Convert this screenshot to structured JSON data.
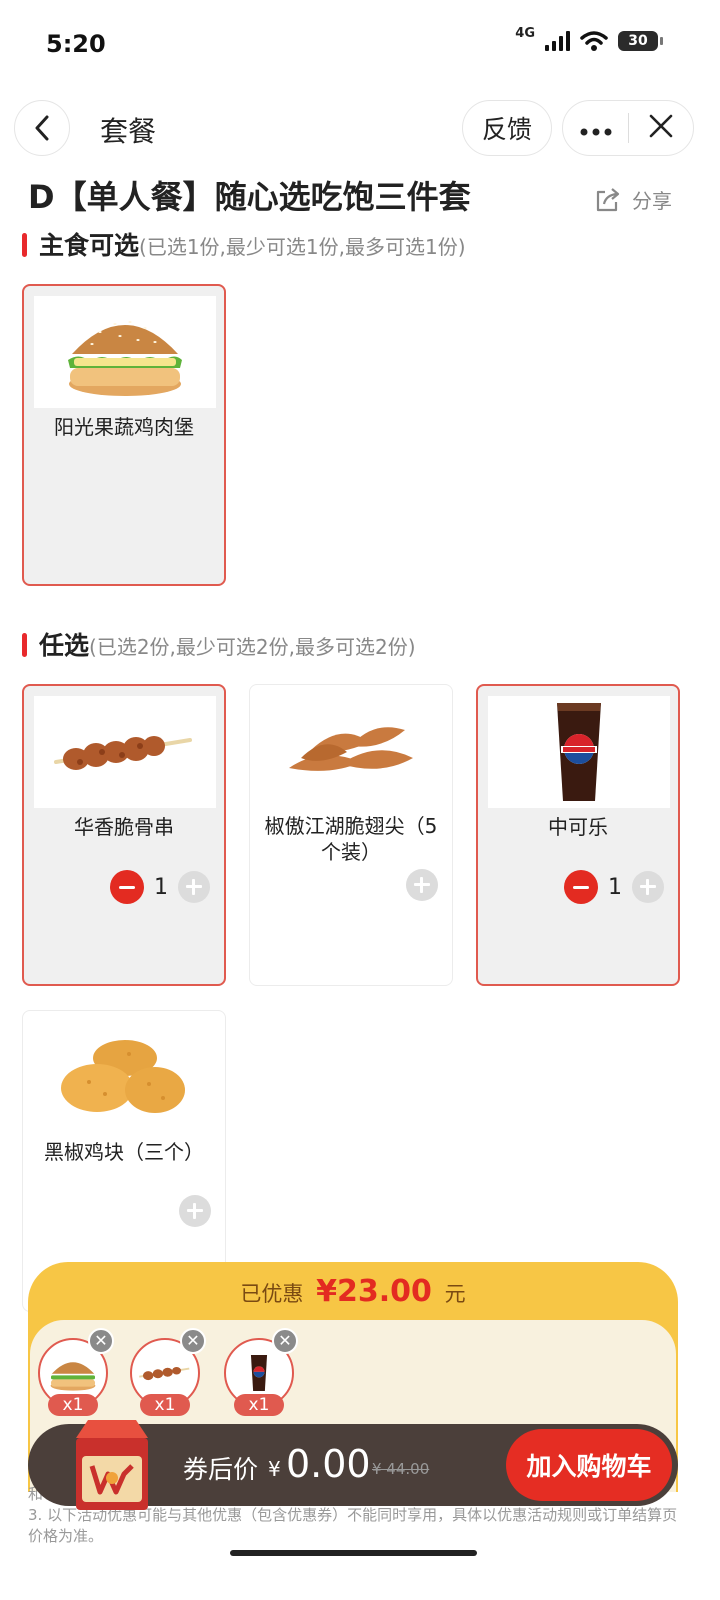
{
  "status": {
    "time": "5:20",
    "network": "4G",
    "battery": "30"
  },
  "nav": {
    "title": "套餐",
    "feedback": "反馈"
  },
  "product": {
    "title": "D【单人餐】随心选吃饱三件套",
    "share": "分享"
  },
  "sections": [
    {
      "name": "主食可选",
      "note": "(已选1份,最少可选1份,最多可选1份)",
      "items": [
        {
          "name": "阳光果蔬鸡肉堡",
          "selected": true,
          "icon": "burger"
        }
      ]
    },
    {
      "name": "任选",
      "note": "(已选2份,最少可选2份,最多可选2份)",
      "items": [
        {
          "name": "华香脆骨串",
          "selected": true,
          "qty": "1",
          "icon": "skewer"
        },
        {
          "name": "椒傲江湖脆翅尖（5个装）",
          "selected": false,
          "icon": "wing-tips"
        },
        {
          "name": "中可乐",
          "selected": true,
          "qty": "1",
          "icon": "cola"
        },
        {
          "name": "黑椒鸡块（三个）",
          "selected": false,
          "icon": "nuggets"
        }
      ]
    }
  ],
  "summary": {
    "saved_prefix": "已优惠",
    "saved_amount": "¥23.00",
    "saved_suffix": "元",
    "picked": [
      {
        "icon": "burger",
        "count": "x1"
      },
      {
        "icon": "skewer",
        "count": "x1"
      },
      {
        "icon": "cola",
        "count": "x1"
      }
    ]
  },
  "cart": {
    "after_label": "券后价",
    "currency": "¥",
    "price": "0.00",
    "original": "¥ 44.00",
    "add_button": "加入购物车"
  },
  "fine_print": [
    "和",
    "3. 以下活动优惠可能与其他优惠（包含优惠券）不能同时享用，具体以优惠活动规则或订单结算页价格为准。"
  ],
  "colors": {
    "accent": "#e32b21",
    "panel": "#f7c645",
    "cart_bar": "#4b3f3a"
  }
}
